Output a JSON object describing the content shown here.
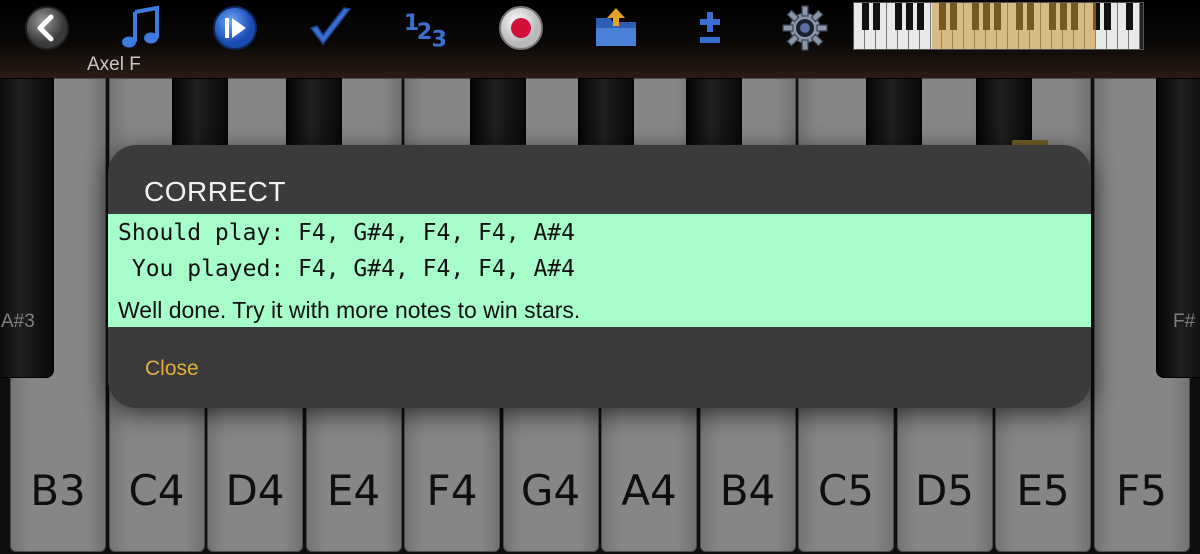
{
  "toolbar": {
    "song_name": "Axel F",
    "icons": [
      "back-icon",
      "music-note-icon",
      "play-step-icon",
      "checkmark-icon",
      "numbers-icon",
      "record-icon",
      "open-folder-icon",
      "plus-minus-icon",
      "settings-gear-icon"
    ],
    "accent": "#2f63c7"
  },
  "keyboard": {
    "white_keys": [
      "B3",
      "C4",
      "D4",
      "E4",
      "F4",
      "G4",
      "A4",
      "B4",
      "C5",
      "D5",
      "E5",
      "F5"
    ],
    "black_key_labels": {
      "left": "A#3",
      "right": "F#"
    }
  },
  "dialog": {
    "title": "CORRECT",
    "should_play_label": "Should play:",
    "should_play_notes": "F4, G#4, F4, F4, A#4",
    "you_played_label": "You played:",
    "you_played_notes": "F4, G#4, F4, F4, A#4",
    "message": "Well done. Try it with more notes to win stars.",
    "close_label": "Close",
    "result_color": "#a7fdca",
    "close_color": "#e0ae3c"
  }
}
